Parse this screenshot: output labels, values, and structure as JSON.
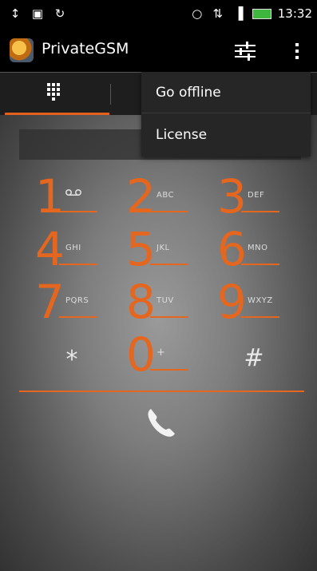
{
  "status_bar": {
    "time": "13:32",
    "icons_left": [
      "usb-icon",
      "image-icon",
      "sync-icon"
    ],
    "icons_right": [
      "alarm-icon",
      "data-transfer-icon",
      "signal-icon",
      "battery-icon"
    ]
  },
  "app": {
    "title": "PrivateGSM"
  },
  "menu": {
    "items": [
      "Go offline",
      "License"
    ]
  },
  "keypad": {
    "keys": [
      {
        "digit": "1",
        "letters": "voicemail"
      },
      {
        "digit": "2",
        "letters": "ABC"
      },
      {
        "digit": "3",
        "letters": "DEF"
      },
      {
        "digit": "4",
        "letters": "GHI"
      },
      {
        "digit": "5",
        "letters": "JKL"
      },
      {
        "digit": "6",
        "letters": "MNO"
      },
      {
        "digit": "7",
        "letters": "PQRS"
      },
      {
        "digit": "8",
        "letters": "TUV"
      },
      {
        "digit": "9",
        "letters": "WXYZ"
      },
      {
        "digit": "0",
        "letters": "+"
      }
    ],
    "star": "*",
    "hash": "#"
  },
  "colors": {
    "accent": "#e5661f",
    "background": "#000000"
  }
}
